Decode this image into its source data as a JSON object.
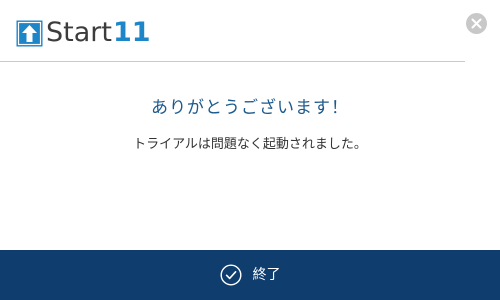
{
  "app": {
    "logo_text": "Start",
    "logo_number": "11",
    "logo_icon": "start-arrow-logo-icon"
  },
  "header": {
    "close_icon": "close-icon"
  },
  "content": {
    "heading": "ありがとうございます！",
    "message": "トライアルは問題なく起動されました。"
  },
  "footer": {
    "finish_label": "終了",
    "finish_icon": "check-circle-icon"
  },
  "colors": {
    "brand_blue": "#1c86c9",
    "heading_blue": "#1d5a8c",
    "footer_navy": "#0f3d6e",
    "close_gray": "#c8c8c8"
  }
}
